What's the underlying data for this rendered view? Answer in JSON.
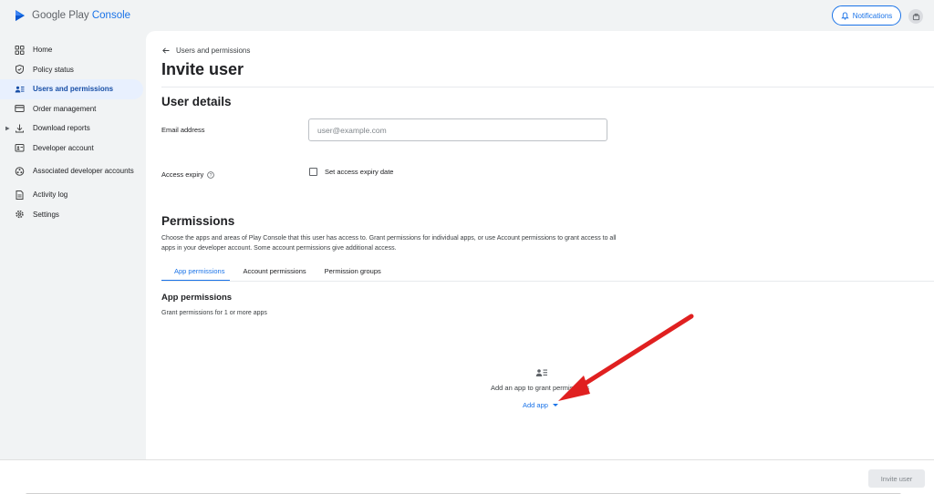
{
  "app": {
    "logo_text_main": "Google Play",
    "logo_text_accent": "Console",
    "notifications_label": "Notifications"
  },
  "sidebar": {
    "items": [
      {
        "label": "Home",
        "icon": "home-grid-icon"
      },
      {
        "label": "Policy status",
        "icon": "shield-icon"
      },
      {
        "label": "Users and permissions",
        "icon": "users-list-icon",
        "active": true
      },
      {
        "label": "Order management",
        "icon": "credit-card-icon"
      },
      {
        "label": "Download reports",
        "icon": "download-icon",
        "expandable": true
      },
      {
        "label": "Developer account",
        "icon": "id-card-icon"
      },
      {
        "label": "Associated developer accounts",
        "icon": "linked-accounts-icon"
      },
      {
        "label": "Activity log",
        "icon": "document-icon"
      },
      {
        "label": "Settings",
        "icon": "gear-icon"
      }
    ]
  },
  "main": {
    "breadcrumb": "Users and permissions",
    "title": "Invite user",
    "user_details": {
      "heading": "User details",
      "email_label": "Email address",
      "email_placeholder": "user@example.com",
      "email_value": "",
      "expiry_label": "Access expiry",
      "expiry_checkbox_label": "Set access expiry date"
    },
    "permissions": {
      "heading": "Permissions",
      "description": "Choose the apps and areas of Play Console that this user has access to. Grant permissions for individual apps, or use Account permissions to grant access to all apps in your developer account. Some account permissions give additional access.",
      "tabs": [
        "App permissions",
        "Account permissions",
        "Permission groups"
      ],
      "active_tab": "App permissions",
      "app_permissions_title": "App permissions",
      "app_permissions_desc": "Grant permissions for 1 or more apps",
      "empty_state_text": "Add an app to grant permissions",
      "add_app_label": "Add app"
    }
  },
  "footer": {
    "invite_button": "Invite user"
  },
  "colors": {
    "accent": "#1a73e8",
    "active_nav_bg": "#e8f0fe",
    "annotation_arrow": "#e02020"
  }
}
